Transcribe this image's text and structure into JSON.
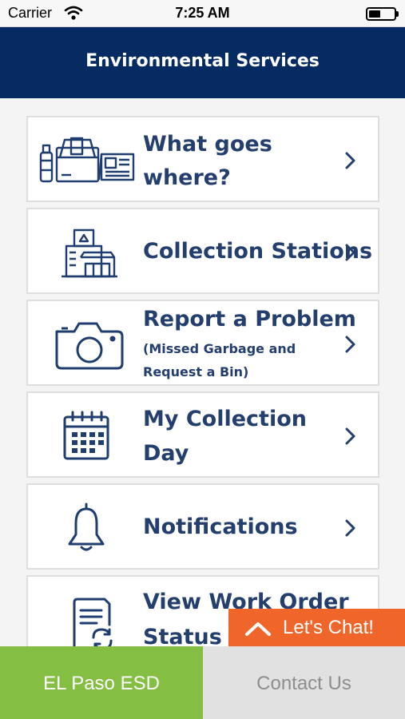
{
  "status_bar": {
    "carrier": "Carrier",
    "time": "7:25 AM"
  },
  "header": {
    "title": "Environmental Services"
  },
  "menu": {
    "items": [
      {
        "title_line1": "What goes",
        "title_line2": "where?",
        "icon": "recycling-items-icon"
      },
      {
        "title": "Collection Stations",
        "icon": "collection-station-building-icon"
      },
      {
        "title": "Report a Problem",
        "subtitle_line1": "(Missed Garbage and",
        "subtitle_line2": "Request a Bin)",
        "icon": "camera-icon"
      },
      {
        "title_line1": "My Collection",
        "title_line2": "Day",
        "icon": "calendar-icon"
      },
      {
        "title": "Notifications",
        "icon": "bell-icon"
      },
      {
        "title_line1": "View Work Order",
        "title_line2": "Status",
        "icon": "work-order-status-icon"
      }
    ]
  },
  "chat": {
    "label": "Let's Chat!"
  },
  "tabs": {
    "home": "EL Paso ESD",
    "contact": "Contact Us"
  },
  "colors": {
    "header_bg": "#062a62",
    "text_primary": "#243e6e",
    "chat_bg": "#f0662a",
    "tab_active_bg": "#84be43",
    "tab_inactive_bg": "#e1e1e1"
  }
}
